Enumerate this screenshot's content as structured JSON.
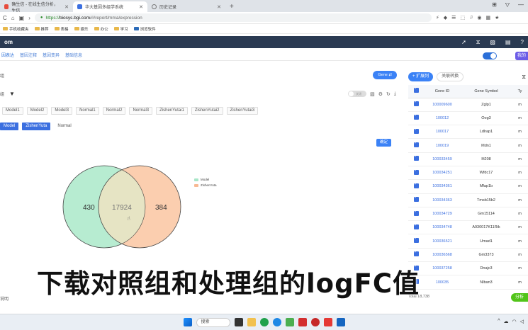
{
  "browser": {
    "tabs": [
      {
        "label": "确生信 - 在线生信分析，生信"
      },
      {
        "label": "华大基因多组学系统"
      },
      {
        "label": "历史记录"
      }
    ],
    "url": {
      "scheme": "https://",
      "domain": "biosys.bgi.com",
      "path": "/#/report/mma/expression"
    },
    "bookmarks": [
      "手机收藏夹",
      "推荐",
      "表格",
      "娱乐",
      "办公",
      "学习",
      "浏览软件"
    ]
  },
  "app": {
    "logo": "om",
    "subnav": [
      "因表达",
      "基因注释",
      "基因变异",
      "基础信息"
    ],
    "purple_btn": "我的"
  },
  "left": {
    "top_label": "组",
    "gene_button": "Gene ⇄",
    "row2_label": "组",
    "toggle_text": "关闭",
    "chips_all": [
      "Model1",
      "Model2",
      "Model3",
      "Normal1",
      "Normal2",
      "Normal3",
      "ZishenYutai1",
      "ZishenYutai2",
      "ZishenYutai3"
    ],
    "chips_groups": [
      {
        "label": "Model",
        "selected": true
      },
      {
        "label": "ZishenYuta",
        "selected": true
      },
      {
        "label": "Normal",
        "selected": false
      }
    ],
    "confirm": "确定",
    "explain": "说明"
  },
  "venn": {
    "left_only": "430",
    "overlap": "17924",
    "right_only": "384",
    "sets": [
      {
        "name": "Model",
        "color": "#a8e6c8"
      },
      {
        "name": "ZishenYuta",
        "color": "#f8b994"
      }
    ]
  },
  "right": {
    "expand_btn": "+ 扩展列",
    "convert_btn": "关联转换",
    "columns": [
      "Gene ID",
      "Gene Symbol",
      "Ty"
    ],
    "rows": [
      {
        "id": "100009600",
        "sym": "Zglp1",
        "t": "m"
      },
      {
        "id": "100012",
        "sym": "Oog3",
        "t": "m"
      },
      {
        "id": "100017",
        "sym": "Ldlrap1",
        "t": "m"
      },
      {
        "id": "100019",
        "sym": "Mdn1",
        "t": "m"
      },
      {
        "id": "100033459",
        "sym": "Ifi208",
        "t": "m"
      },
      {
        "id": "100034251",
        "sym": "Wfdc17",
        "t": "m"
      },
      {
        "id": "100034361",
        "sym": "Mfap1b",
        "t": "m"
      },
      {
        "id": "100034363",
        "sym": "Tmsb15b2",
        "t": "m"
      },
      {
        "id": "100034729",
        "sym": "Gm15114",
        "t": "m"
      },
      {
        "id": "100034748",
        "sym": "A930017K11Rik",
        "t": "m"
      },
      {
        "id": "100036521",
        "sym": "Umad1",
        "t": "m"
      },
      {
        "id": "100036568",
        "sym": "Gm3373",
        "t": "m"
      },
      {
        "id": "100037258",
        "sym": "Dnajc3",
        "t": "m"
      },
      {
        "id": "100035",
        "sym": "Nlban3",
        "t": "m"
      }
    ],
    "total": "Total 18,738",
    "analyze": "分析"
  },
  "subtitle": "下载对照组和处理组的logFC值",
  "taskbar": {
    "search": "搜索"
  }
}
